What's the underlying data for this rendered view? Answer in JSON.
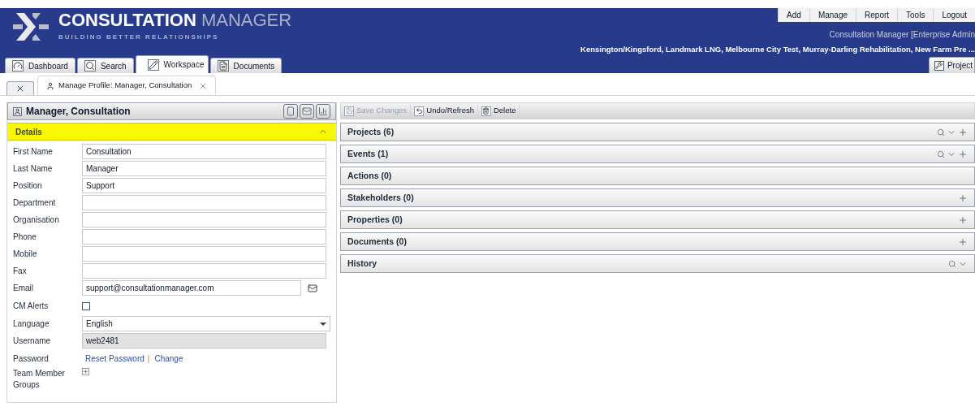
{
  "header": {
    "brand_bold": "CONSULTATION",
    "brand_light": "MANAGER",
    "tagline": "BUILDING BETTER RELATIONSHIPS",
    "menu": [
      "Add",
      "Manage",
      "Report",
      "Tools",
      "Logout"
    ],
    "user_line": "Consultation Manager [Enterprise Admin",
    "projects_line": "Kensington/Kingsford, Landmark LNG, Melbourne City Test, Murray-Darling Rehabilitation, New Farm Pre ...",
    "projects_button": "Project"
  },
  "tabs": [
    {
      "label": "Dashboard",
      "selected": false
    },
    {
      "label": "Search",
      "selected": false
    },
    {
      "label": "Workspace",
      "selected": true
    },
    {
      "label": "Documents",
      "selected": false
    }
  ],
  "subtab": {
    "label": "Manage Profile: Manager, Consultation"
  },
  "profile": {
    "title": "Manager, Consultation",
    "section": "Details",
    "fields": [
      {
        "kind": "text",
        "label": "First Name",
        "value": "Consultation"
      },
      {
        "kind": "text",
        "label": "Last Name",
        "value": "Manager"
      },
      {
        "kind": "text",
        "label": "Position",
        "value": "Support"
      },
      {
        "kind": "text",
        "label": "Department"
      },
      {
        "kind": "text",
        "label": "Organisation"
      },
      {
        "kind": "text",
        "label": "Phone"
      },
      {
        "kind": "text",
        "label": "Mobile"
      },
      {
        "kind": "text",
        "label": "Fax"
      },
      {
        "kind": "email",
        "label": "Email",
        "value": "support@consultationmanager.com"
      },
      {
        "kind": "checkbox",
        "label": "CM Alerts",
        "checked": false
      },
      {
        "kind": "select",
        "label": "Language",
        "value": "English"
      },
      {
        "kind": "readonly",
        "label": "Username",
        "value": "web2481"
      },
      {
        "kind": "links",
        "label": "Password",
        "links": [
          "Reset Password",
          "Change"
        ],
        "separator": "|"
      },
      {
        "kind": "expand",
        "label": "Team Member Groups"
      }
    ]
  },
  "toolbar": [
    {
      "label": "Save Changes",
      "disabled": true
    },
    {
      "label": "Undo/Refresh",
      "disabled": false
    },
    {
      "label": "Delete",
      "disabled": false
    }
  ],
  "sections": [
    {
      "title": "Projects (6)",
      "search": true,
      "menu": true,
      "add": true
    },
    {
      "title": "Events (1)",
      "search": true,
      "menu": true,
      "add": true
    },
    {
      "title": "Actions (0)",
      "search": false,
      "menu": false,
      "add": false
    },
    {
      "title": "Stakeholders (0)",
      "search": false,
      "menu": false,
      "add": true
    },
    {
      "title": "Properties (0)",
      "search": false,
      "menu": false,
      "add": true
    },
    {
      "title": "Documents (0)",
      "search": false,
      "menu": false,
      "add": true
    },
    {
      "title": "History",
      "search": true,
      "menu": true,
      "add": false
    }
  ]
}
